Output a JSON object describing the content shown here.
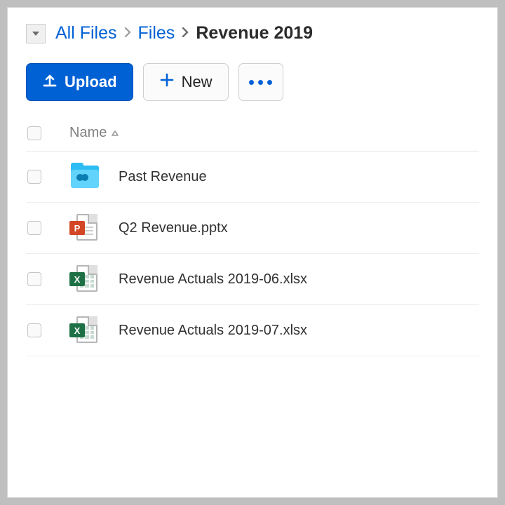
{
  "breadcrumb": {
    "root": "All Files",
    "parent": "Files",
    "current": "Revenue 2019"
  },
  "toolbar": {
    "upload_label": "Upload",
    "new_label": "New"
  },
  "columns": {
    "name": "Name"
  },
  "items": [
    {
      "type": "folder",
      "name": "Past Revenue"
    },
    {
      "type": "pptx",
      "name": "Q2 Revenue.pptx"
    },
    {
      "type": "xlsx",
      "name": "Revenue Actuals 2019-06.xlsx"
    },
    {
      "type": "xlsx",
      "name": "Revenue Actuals 2019-07.xlsx"
    }
  ]
}
